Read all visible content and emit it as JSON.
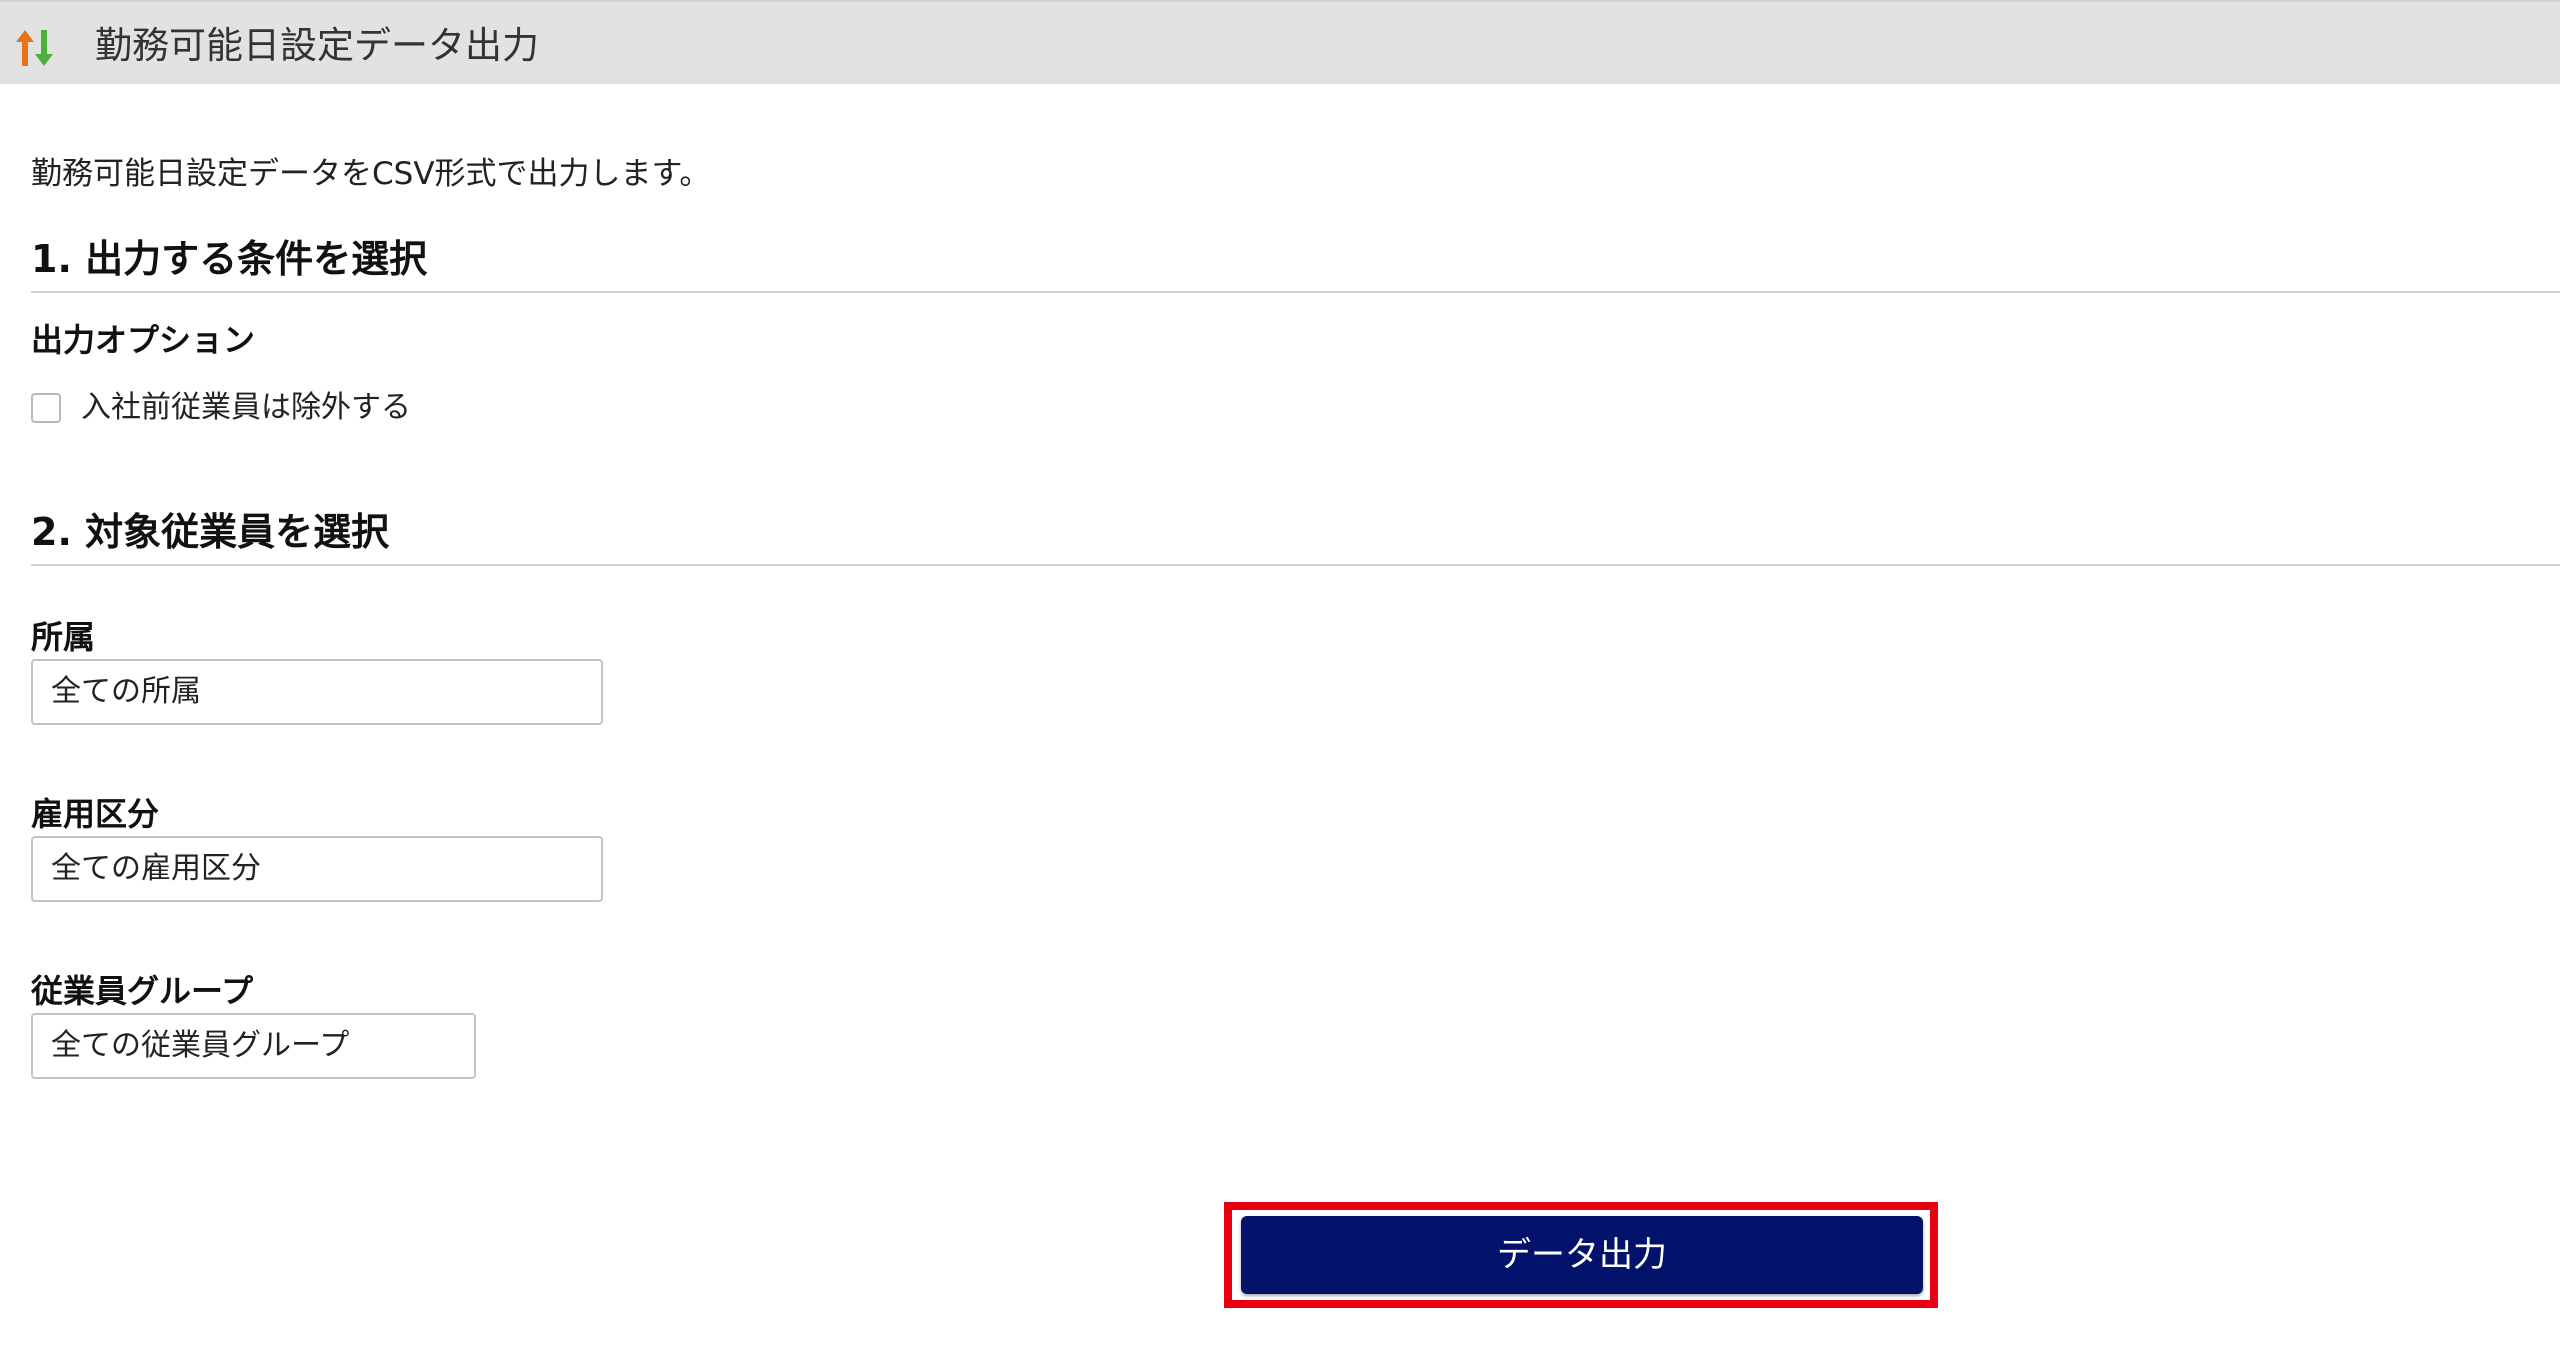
{
  "header": {
    "icon": "sort-arrows-icon",
    "title": "勤務可能日設定データ出力"
  },
  "description": "勤務可能日設定データをCSV形式で出力します。",
  "section1": {
    "title": "1. 出力する条件を選択",
    "output_options": {
      "label": "出力オプション",
      "checkbox_label": "入社前従業員は除外する",
      "checked": false
    }
  },
  "section2": {
    "title": "2. 対象従業員を選択",
    "affiliation": {
      "label": "所属",
      "value": "全ての所属"
    },
    "employment_type": {
      "label": "雇用区分",
      "value": "全ての雇用区分"
    },
    "employee_group": {
      "label": "従業員グループ",
      "value": "全ての従業員グループ"
    }
  },
  "actions": {
    "export_label": "データ出力"
  },
  "colors": {
    "header_bg": "#e2e2e2",
    "button_bg": "#03126a",
    "highlight": "#e60012",
    "arrow_up": "#e8731a",
    "arrow_down": "#4caf3a"
  }
}
